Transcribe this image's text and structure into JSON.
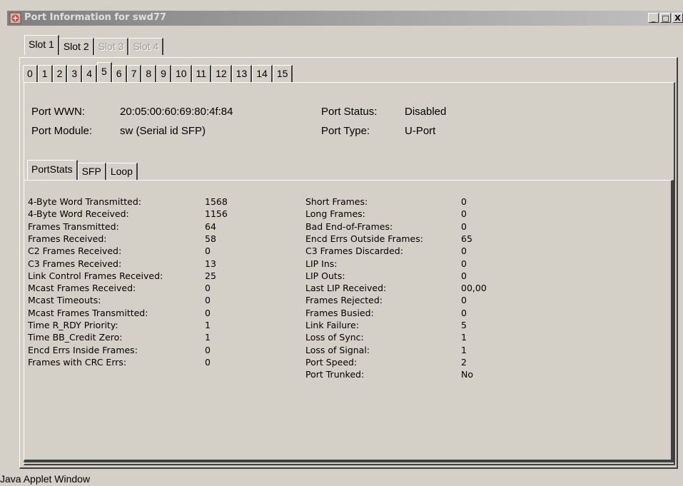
{
  "window": {
    "title": "Port Information for swd77",
    "buttons": [
      "_",
      "□",
      "X"
    ]
  },
  "slot_tabs": [
    {
      "label": "Slot 1",
      "active": true,
      "enabled": true
    },
    {
      "label": "Slot 2",
      "active": false,
      "enabled": true
    },
    {
      "label": "Slot 3",
      "active": false,
      "enabled": false
    },
    {
      "label": "Slot 4",
      "active": false,
      "enabled": false
    }
  ],
  "port_tabs": [
    {
      "label": "0"
    },
    {
      "label": "1"
    },
    {
      "label": "2"
    },
    {
      "label": "3"
    },
    {
      "label": "4"
    },
    {
      "label": "5",
      "active": true
    },
    {
      "label": "6"
    },
    {
      "label": "7"
    },
    {
      "label": "8"
    },
    {
      "label": "9"
    },
    {
      "label": "10"
    },
    {
      "label": "11"
    },
    {
      "label": "12"
    },
    {
      "label": "13"
    },
    {
      "label": "14"
    },
    {
      "label": "15"
    }
  ],
  "port_info": {
    "wwn_label": "Port WWN:",
    "wwn_value": "20:05:00:60:69:80:4f:84",
    "module_label": "Port Module:",
    "module_value": "sw (Serial id SFP)",
    "status_label": "Port Status:",
    "status_value": "Disabled",
    "type_label": "Port Type:",
    "type_value": "U-Port"
  },
  "stat_tabs": [
    {
      "label": "PortStats",
      "active": true
    },
    {
      "label": "SFP"
    },
    {
      "label": "Loop"
    }
  ],
  "stats_left": [
    {
      "label": "4-Byte Word Transmitted:",
      "value": "1568"
    },
    {
      "label": "4-Byte Word Received:",
      "value": "1156"
    },
    {
      "label": "Frames Transmitted:",
      "value": "64"
    },
    {
      "label": "Frames Received:",
      "value": "58"
    },
    {
      "label": "C2 Frames Received:",
      "value": "0"
    },
    {
      "label": "C3 Frames Received:",
      "value": "13"
    },
    {
      "label": "Link Control Frames Received:",
      "value": "25"
    },
    {
      "label": "Mcast Frames Received:",
      "value": "0"
    },
    {
      "label": "Mcast Timeouts:",
      "value": "0"
    },
    {
      "label": "Mcast Frames Transmitted:",
      "value": "0"
    },
    {
      "label": "Time R_RDY Priority:",
      "value": "1"
    },
    {
      "label": "Time BB_Credit Zero:",
      "value": "1"
    },
    {
      "label": "Encd Errs Inside Frames:",
      "value": "0"
    },
    {
      "label": "Frames with CRC Errs:",
      "value": "0"
    }
  ],
  "stats_right": [
    {
      "label": "Short Frames:",
      "value": "0"
    },
    {
      "label": "Long Frames:",
      "value": "0"
    },
    {
      "label": "Bad End-of-Frames:",
      "value": "0"
    },
    {
      "label": "Encd Errs Outside Frames:",
      "value": "65"
    },
    {
      "label": "C3 Frames Discarded:",
      "value": "0"
    },
    {
      "label": "LIP Ins:",
      "value": "0"
    },
    {
      "label": "LIP Outs:",
      "value": "0"
    },
    {
      "label": "Last LIP Received:",
      "value": "00,00"
    },
    {
      "label": "Frames Rejected:",
      "value": "0"
    },
    {
      "label": "Frames Busied:",
      "value": "0"
    },
    {
      "label": "Link Failure:",
      "value": "5"
    },
    {
      "label": "Loss of Sync:",
      "value": "1"
    },
    {
      "label": "Loss of Signal:",
      "value": "1"
    },
    {
      "label": "Port Speed:",
      "value": "2"
    },
    {
      "label": "Port Trunked:",
      "value": "No"
    }
  ],
  "status_bar": {
    "text": "Java Applet Window"
  }
}
